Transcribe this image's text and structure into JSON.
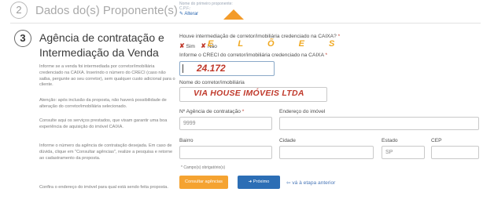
{
  "step2": {
    "number": "2",
    "title": "Dados do(s) Proponente(s)",
    "proponent_name_label": "Nome do primeiro proponente:",
    "cpf_label": "C.P.F.:",
    "edit_link": "✎ Alterar"
  },
  "step3": {
    "number": "3",
    "title": "Agência de contratação e Intermediação da Venda",
    "paragraphs": [
      "Informe se a venda foi intermediada por corretor/imobiliária credenciado na CAIXA. Inserindo o número do CRECI (caso não saiba, pergunte ao seu corretor), sem qualquer custo adicional para o cliente.",
      "Atenção: após inclusão da proposta, não haverá possibilidade de alteração do corretor/imobiliária selecionado.",
      "Consulte aqui os serviços prestados, que visam garantir uma boa experiência de aquisição do imóvel CAIXA.",
      "Informe o número da agência de contratação desejada. Em caso de dúvida, clique em \"Consultar agências\", realize a pesquisa e retorne ao cadastramento da proposta.",
      "Confira o endereço do imóvel para qual está sendo feita proposta."
    ]
  },
  "form": {
    "question": "Houve intermediação de corretor/imobiliária credenciado na CAIXA?",
    "question_star": "*",
    "radio_yes": "Sim",
    "radio_no": "Não",
    "overlay_letters": "E L Õ E S",
    "creci_label": "Informe o CRECI do corretor/imobiliária credenciado na CAIXA",
    "creci_star": "*",
    "creci_value": "24.172",
    "name_label": "Nome do corretor/imobiliária",
    "name_value": "VIA HOUSE IMÓVEIS LTDA",
    "agency_label": "Nº Agência de contratação",
    "agency_star": "*",
    "agency_value": "9999",
    "address_label": "Endereço do imóvel",
    "district_label": "Bairro",
    "city_label": "Cidade",
    "state_label": "Estado",
    "state_value": "SP",
    "cep_label": "CEP",
    "required_note": "* Campo(s) obrigatório(s)"
  },
  "buttons": {
    "consult": "Consultar agências",
    "next": "➜ Próximo",
    "back": "⇦ vá à etapa anterior"
  }
}
